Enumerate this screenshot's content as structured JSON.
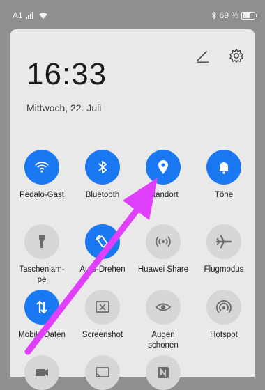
{
  "status": {
    "carrier": "A1",
    "battery_text": "69 %",
    "battery_level": 0.69
  },
  "header": {
    "time": "16:33",
    "date": "Mittwoch, 22. Juli"
  },
  "tiles": [
    {
      "label": "Pedalo-Gast",
      "icon": "wifi-icon",
      "active": true
    },
    {
      "label": "Bluetooth",
      "icon": "bluetooth-icon",
      "active": true
    },
    {
      "label": "Standort",
      "icon": "location-icon",
      "active": true
    },
    {
      "label": "Töne",
      "icon": "bell-icon",
      "active": true
    },
    {
      "label": "Taschenlam-\npe",
      "icon": "flashlight-icon",
      "active": false
    },
    {
      "label": "Auto-Drehen",
      "icon": "auto-rotate-icon",
      "active": true
    },
    {
      "label": "Huawei Share",
      "icon": "share-icon",
      "active": false
    },
    {
      "label": "Flugmodus",
      "icon": "airplane-icon",
      "active": false
    },
    {
      "label": "Mobile Daten",
      "icon": "mobile-data-icon",
      "active": true
    },
    {
      "label": "Screenshot",
      "icon": "screenshot-icon",
      "active": false
    },
    {
      "label": "Augen\nschonen",
      "icon": "eye-icon",
      "active": false
    },
    {
      "label": "Hotspot",
      "icon": "hotspot-icon",
      "active": false
    },
    {
      "label": "",
      "icon": "video-icon",
      "active": false
    },
    {
      "label": "",
      "icon": "cast-icon",
      "active": false
    },
    {
      "label": "",
      "icon": "nfc-icon",
      "active": false
    }
  ],
  "colors": {
    "active": "#1a78f2",
    "inactive": "#d6d6d6",
    "annotation_arrow": "#e040fb"
  }
}
